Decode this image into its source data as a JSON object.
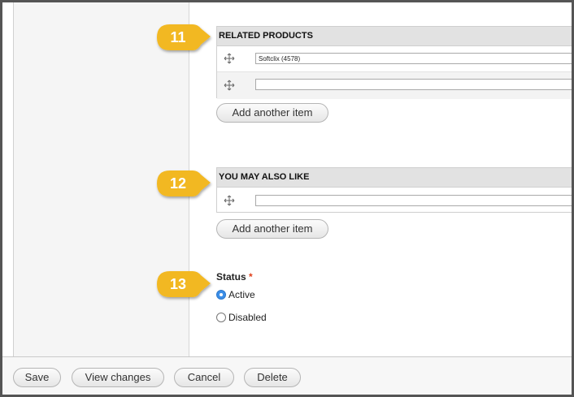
{
  "related_products": {
    "header": "RELATED PRODUCTS",
    "rows": [
      {
        "value": "Softclix (4578)"
      },
      {
        "value": ""
      }
    ],
    "add_label": "Add another item"
  },
  "you_may_also_like": {
    "header": "YOU MAY ALSO LIKE",
    "rows": [
      {
        "value": ""
      }
    ],
    "add_label": "Add another item"
  },
  "status": {
    "label": "Status",
    "required_mark": "*",
    "options": [
      {
        "label": "Active",
        "selected": true
      },
      {
        "label": "Disabled",
        "selected": false
      }
    ]
  },
  "callouts": [
    {
      "number": "11"
    },
    {
      "number": "12"
    },
    {
      "number": "13"
    }
  ],
  "actions": {
    "save": "Save",
    "view_changes": "View changes",
    "cancel": "Cancel",
    "delete": "Delete"
  },
  "colors": {
    "callout": "#f2b824",
    "radio_selected": "#3b8ee8",
    "required": "#e0401c"
  },
  "icons": {
    "drag_handle": "move-arrows-icon"
  }
}
